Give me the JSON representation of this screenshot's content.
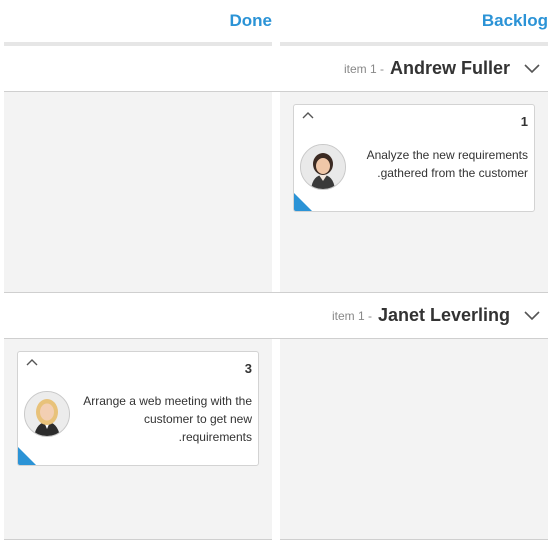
{
  "columns": [
    {
      "title": "Done"
    },
    {
      "title": "Backlog"
    }
  ],
  "swimlanes": [
    {
      "name": "Andrew Fuller",
      "count": "item 1 -"
    },
    {
      "name": "Janet Leverling",
      "count": "item 1 -"
    }
  ],
  "cards": [
    {
      "id": "1",
      "content_line1": "Analyze the new requirements",
      "content_line2": ".gathered from the customer",
      "assignee_avatar": "woman-avatar-dark-hair"
    },
    {
      "id": "3",
      "content_line1": "Arrange a web meeting with the",
      "content_line2": "customer to get new",
      "content_line3": ".requirements",
      "assignee_avatar": "woman-avatar-blonde"
    }
  ],
  "colors": {
    "accent": "#2b93d6",
    "cell_bg": "#f3f3f3"
  }
}
